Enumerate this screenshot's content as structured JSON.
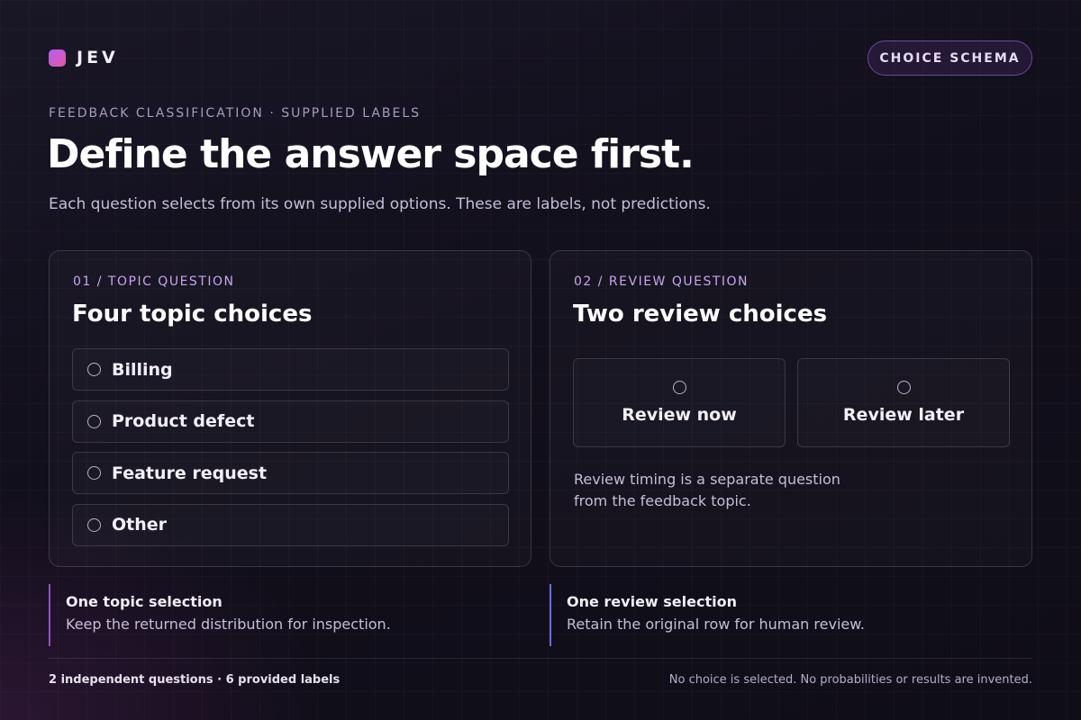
{
  "brand": {
    "name": "JEV",
    "mark_gradient": [
      "#b85cf0",
      "#e05aa6"
    ]
  },
  "header": {
    "pill_label": "CHOICE SCHEMA"
  },
  "intro": {
    "eyebrow": "FEEDBACK CLASSIFICATION · SUPPLIED LABELS",
    "headline": "Define the answer space first.",
    "subtitle": "Each question selects from its own supplied options. These are labels, not predictions."
  },
  "questions": {
    "topic": {
      "kicker": "01 / TOPIC QUESTION",
      "title": "Four topic choices",
      "options": [
        {
          "label": "Billing",
          "selected": false
        },
        {
          "label": "Product defect",
          "selected": false
        },
        {
          "label": "Feature request",
          "selected": false
        },
        {
          "label": "Other",
          "selected": false
        }
      ]
    },
    "review": {
      "kicker": "02 / REVIEW QUESTION",
      "title": "Two review choices",
      "options": [
        {
          "label": "Review now",
          "selected": false
        },
        {
          "label": "Review later",
          "selected": false
        }
      ],
      "note": "Review timing is a separate question from the feedback topic."
    }
  },
  "notes": {
    "topic": {
      "title": "One topic selection",
      "body": "Keep the returned distribution for inspection."
    },
    "review": {
      "title": "One review selection",
      "body": "Retain the original row for human review."
    }
  },
  "footer": {
    "left": "2 independent questions · 6 provided labels",
    "right": "No choice is selected. No probabilities or results are invented."
  },
  "colors": {
    "accent_purple": "#9a4bd4",
    "accent_indigo": "#6c6fd6",
    "kicker": "#c4a6ee",
    "background": "#120f1c"
  }
}
